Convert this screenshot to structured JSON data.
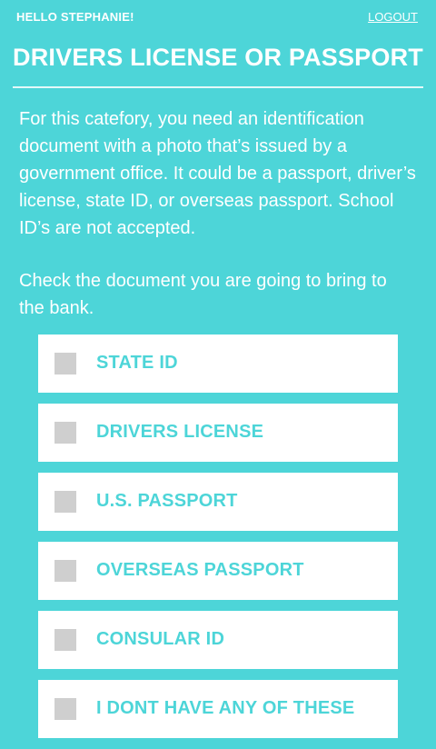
{
  "header": {
    "greeting": "HELLO STEPHANIE!",
    "logout_label": "LOGOUT"
  },
  "page": {
    "title": "DRIVERS LICENSE OR PASSPORT",
    "description": "For this catefory, you need an identification document with a photo that’s issued by a government office. It could be a passport, driver’s license, state ID, or overseas passport. School ID’s are not accepted.",
    "instruction": "Check the document you are going to bring to the bank."
  },
  "options": [
    {
      "label": "STATE ID",
      "checked": false
    },
    {
      "label": "DRIVERS LICENSE",
      "checked": false
    },
    {
      "label": "U.S. PASSPORT",
      "checked": false
    },
    {
      "label": "OVERSEAS PASSPORT",
      "checked": false
    },
    {
      "label": "CONSULAR ID",
      "checked": false
    },
    {
      "label": "I DONT HAVE ANY OF THESE",
      "checked": false
    }
  ],
  "colors": {
    "background": "#4dd5d8",
    "card": "#ffffff",
    "checkbox": "#cfcfcf",
    "accent_text": "#4dd5d8"
  }
}
